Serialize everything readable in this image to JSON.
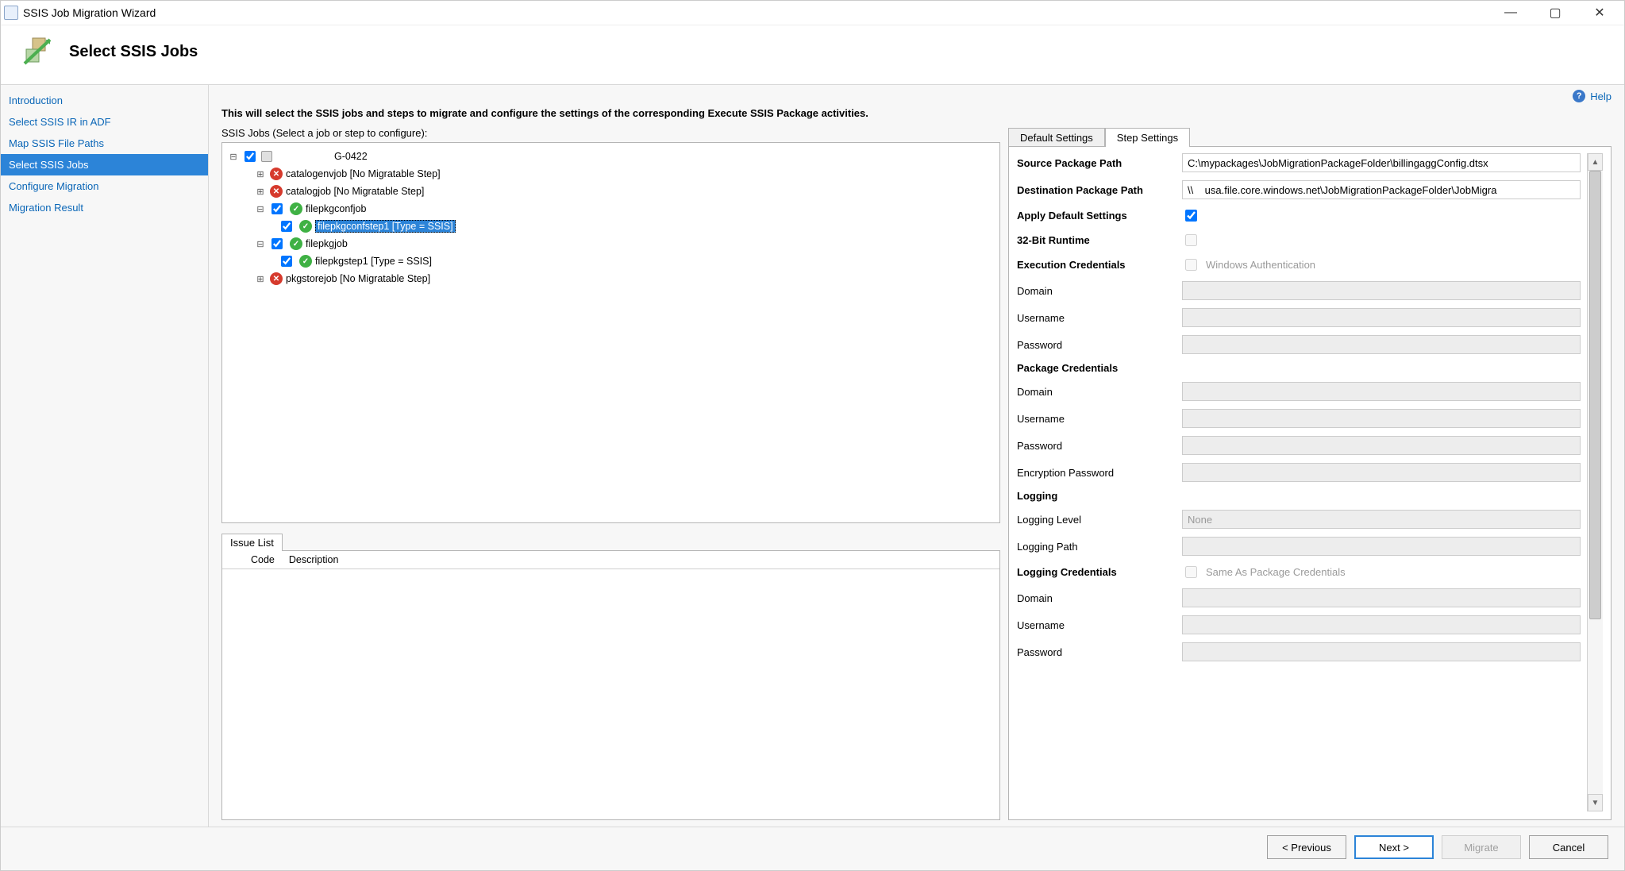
{
  "window": {
    "title": "SSIS Job Migration Wizard",
    "page_title": "Select SSIS Jobs"
  },
  "help": {
    "label": "Help"
  },
  "sidebar": {
    "items": [
      {
        "label": "Introduction"
      },
      {
        "label": "Select SSIS IR in ADF"
      },
      {
        "label": "Map SSIS File Paths"
      },
      {
        "label": "Select SSIS Jobs"
      },
      {
        "label": "Configure Migration"
      },
      {
        "label": "Migration Result"
      }
    ],
    "selected_index": 3
  },
  "instruction": "This will select the SSIS jobs and steps to migrate and configure the settings of the corresponding Execute SSIS Package activities.",
  "tree": {
    "label": "SSIS Jobs (Select a job or step to configure):",
    "root": "G-0422",
    "jobs": [
      {
        "label": "catalogenvjob [No Migratable Step]"
      },
      {
        "label": "catalogjob [No Migratable Step]"
      },
      {
        "label": "filepkgconfjob",
        "child": "filepkgconfstep1 [Type = SSIS]"
      },
      {
        "label": "filepkgjob",
        "child": "filepkgstep1 [Type = SSIS]"
      },
      {
        "label": "pkgstorejob [No Migratable Step]"
      }
    ]
  },
  "issue": {
    "title": "Issue List",
    "code_col": "Code",
    "desc_col": "Description"
  },
  "tabs": {
    "default": "Default Settings",
    "step": "Step Settings"
  },
  "settings": {
    "source_label": "Source Package Path",
    "source_value": "C:\\mypackages\\JobMigrationPackageFolder\\billingaggConfig.dtsx",
    "dest_label": "Destination Package Path",
    "dest_value": "\\\\    usa.file.core.windows.net\\JobMigrationPackageFolder\\JobMigra",
    "apply_label": "Apply Default Settings",
    "bit32_label": "32-Bit Runtime",
    "exec_cred": "Execution Credentials",
    "exec_cred_opt": "Windows Authentication",
    "domain": "Domain",
    "username": "Username",
    "password": "Password",
    "pkg_cred": "Package Credentials",
    "enc_pwd": "Encryption Password",
    "logging": "Logging",
    "log_level": "Logging Level",
    "log_level_val": "None",
    "log_path": "Logging Path",
    "log_cred": "Logging Credentials",
    "log_cred_opt": "Same As Package Credentials"
  },
  "footer": {
    "previous": "< Previous",
    "next": "Next >",
    "migrate": "Migrate",
    "cancel": "Cancel"
  }
}
